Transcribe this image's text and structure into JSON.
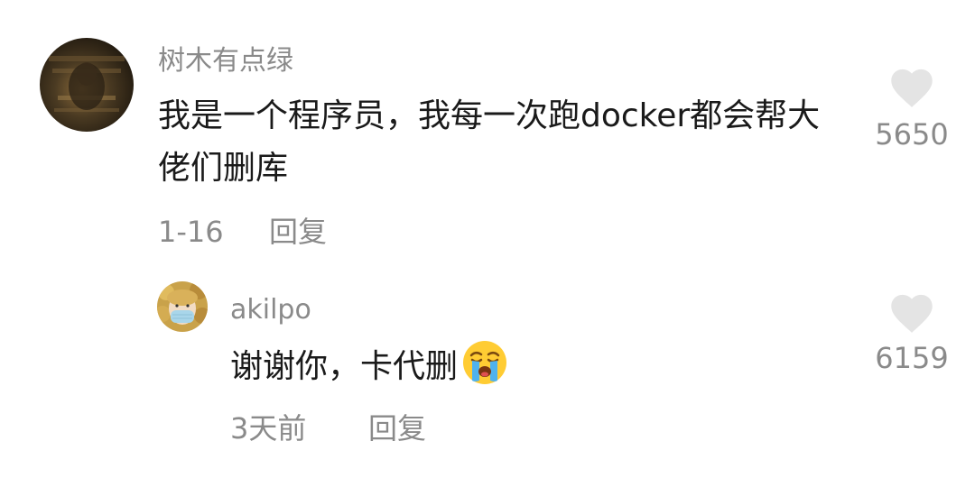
{
  "comments": [
    {
      "avatar_icon": "dark-photo-avatar",
      "username": "树木有点绿",
      "text": "我是一个程序员，我每一次跑docker都会帮大佬们删库",
      "date": "1-16",
      "reply_label": "回复",
      "like_icon": "heart-icon",
      "like_count": "5650",
      "reply": {
        "avatar_icon": "masked-face-avatar",
        "username": "akilpo",
        "text": "谢谢你，卡代删",
        "emoji": "loudly-crying-face-emoji",
        "date": "3天前",
        "reply_label": "回复",
        "like_icon": "heart-icon",
        "like_count": "6159"
      }
    }
  ],
  "colors": {
    "text_primary": "#1a1a1a",
    "text_secondary": "#8a8a8a",
    "heart": "#e4e4e4"
  }
}
